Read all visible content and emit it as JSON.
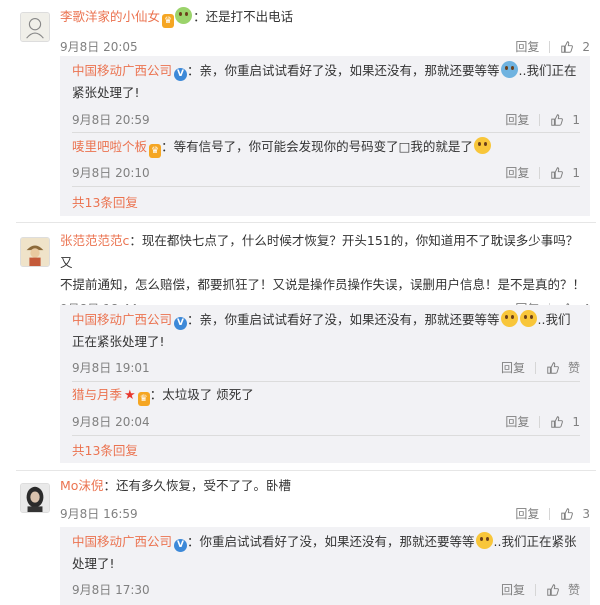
{
  "comments": [
    {
      "user": "李歌洋家的小仙女",
      "text": "：还是打不出电话",
      "time": "9月8日 20:05",
      "reply_label": "回复",
      "likes": "2",
      "sub_replies": [
        {
          "user": "中国移动广西公司",
          "text": "：亲，你重启试试看好了没，如果还没有，那就还要等等",
          "text_tail": "..我们正在",
          "text_line2": "紧张处理了!",
          "time": "9月8日 20:59",
          "reply_label": "回复",
          "likes": "1"
        },
        {
          "user": "唛里吧啦个板",
          "text": "：等有信号了，你可能会发现你的号码变了□我的就是了",
          "time": "9月8日 20:10",
          "reply_label": "回复",
          "likes": "1"
        }
      ],
      "more": "共13条回复"
    },
    {
      "user": "张范范范范c",
      "text": "：现在都快七点了，什么时候才恢复？开头151的，你知道用不了耽误多少事吗？又",
      "text_line2": "不提前通知，怎么赔偿，都要抓狂了！又说是操作员操作失误，误删用户信息！是不是真的？！",
      "time": "9月8日 18:44",
      "reply_label": "回复",
      "likes": "4",
      "sub_replies": [
        {
          "user": "中国移动广西公司",
          "text": "：亲，你重启试试看好了没，如果还没有，那就还要等等",
          "text_tail": "..我们",
          "text_line2": "正在紧张处理了!",
          "time": "9月8日 19:01",
          "reply_label": "回复",
          "likes": "赞"
        },
        {
          "user": "猎与月季",
          "text": "：太垃圾了 烦死了",
          "time": "9月8日 20:04",
          "reply_label": "回复",
          "likes": "1"
        }
      ],
      "more": "共13条回复"
    },
    {
      "user": "Mo沫倪",
      "text": "：还有多久恢复，受不了了。卧槽",
      "time": "9月8日 16:59",
      "reply_label": "回复",
      "likes": "3",
      "sub_replies": [
        {
          "user": "中国移动广西公司",
          "text": "：你重启试试看好了没，如果还没有，那就还要等等",
          "text_tail": "..我们正在紧张",
          "text_line2": "处理了!",
          "time": "9月8日 17:30",
          "reply_label": "回复",
          "likes": "赞"
        }
      ]
    }
  ],
  "icons": {
    "verified": "verified-badge-icon",
    "like": "thumbs-up-icon",
    "emoji": "emoji-icon"
  },
  "colors": {
    "username": "#eb7350",
    "sub_bg": "#f2f2f5",
    "meta": "#808080",
    "verified": "#3d89d8"
  }
}
